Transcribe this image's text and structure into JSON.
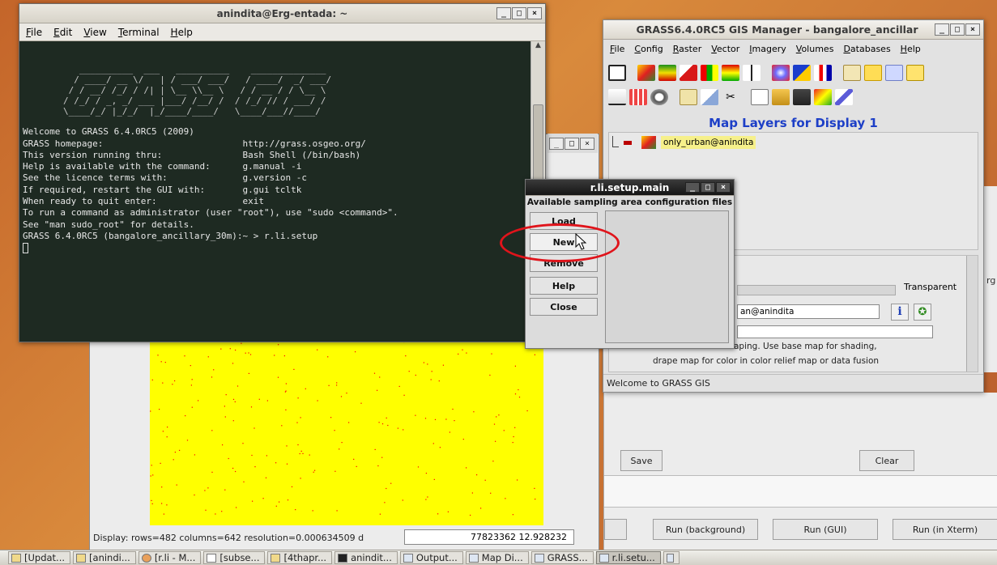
{
  "terminal": {
    "title": "anindita@Erg-entada: ~",
    "menu": [
      "File",
      "Edit",
      "View",
      "Terminal",
      "Help"
    ],
    "ascii_art": "   __________  ___   __________    ______________\n  / ____/ __ \\/   | / ___/ ___/   / ____/  _/ ___/\n / / __/ /_/ / /| | \\__ \\\\__ \\   / / __ / / \\__ \\\n/ /_/ / _, _/ ___ |___/ /__/ /  / /_/ // / ___/ /\n\\____/_/ |_/_/  |_/____/____/   \\____/___//____/",
    "lines": [
      "Welcome to GRASS 6.4.0RC5 (2009)",
      "GRASS homepage:                          http://grass.osgeo.org/",
      "This version running thru:               Bash Shell (/bin/bash)",
      "Help is available with the command:      g.manual -i",
      "See the licence terms with:              g.version -c",
      "If required, restart the GUI with:       g.gui tcltk",
      "When ready to quit enter:                exit",
      "",
      "To run a command as administrator (user \"root\"), use \"sudo <command>\".",
      "See \"man sudo_root\" for details.",
      "",
      "GRASS 6.4.0RC5 (bangalore_ancillary_30m):~ > r.li.setup"
    ]
  },
  "gis_manager": {
    "title": "GRASS6.4.0RC5 GIS Manager - bangalore_ancillar",
    "menu": [
      "File",
      "Config",
      "Raster",
      "Vector",
      "Imagery",
      "Volumes",
      "Databases",
      "Help"
    ],
    "layers_heading": "Map Layers for Display 1",
    "layer_name": "only_urban@anindita",
    "transparent_label": "Transparent",
    "map_field_value": "an@anindita",
    "hint_line1": "aping. Use base map for shading,",
    "hint_line2": "drape map for color in color relief map or data fusion",
    "status": "Welcome to GRASS GIS",
    "info_icon": "i",
    "edge_label": "rg"
  },
  "lower_panel": {
    "save": "Save",
    "clear": "Clear",
    "run_background": "Run (background)",
    "run_gui": "Run (GUI)",
    "run_xterm": "Run (in Xterm)"
  },
  "display": {
    "status": "Display: rows=482  columns=642  resolution=0.000634509 d",
    "coords": "77823362  12.928232"
  },
  "rli_setup": {
    "title": "r.li.setup.main",
    "heading": "Available sampling area configuration files",
    "buttons": {
      "load": "Load",
      "new": "New",
      "remove": "Remove",
      "help": "Help",
      "close": "Close"
    }
  },
  "taskbar": {
    "items": [
      "[Updat...",
      "[anindi...",
      "[r.li - M...",
      "[subse...",
      "[4thapr...",
      "anindit...",
      "Output...",
      "Map Di...",
      "GRASS...",
      "r.li.setu..."
    ]
  },
  "colors": {
    "map_background": "#ffff00",
    "map_urban": "#ff0000",
    "highlight": "#e0141b",
    "heading_blue": "#1d3fc7"
  }
}
